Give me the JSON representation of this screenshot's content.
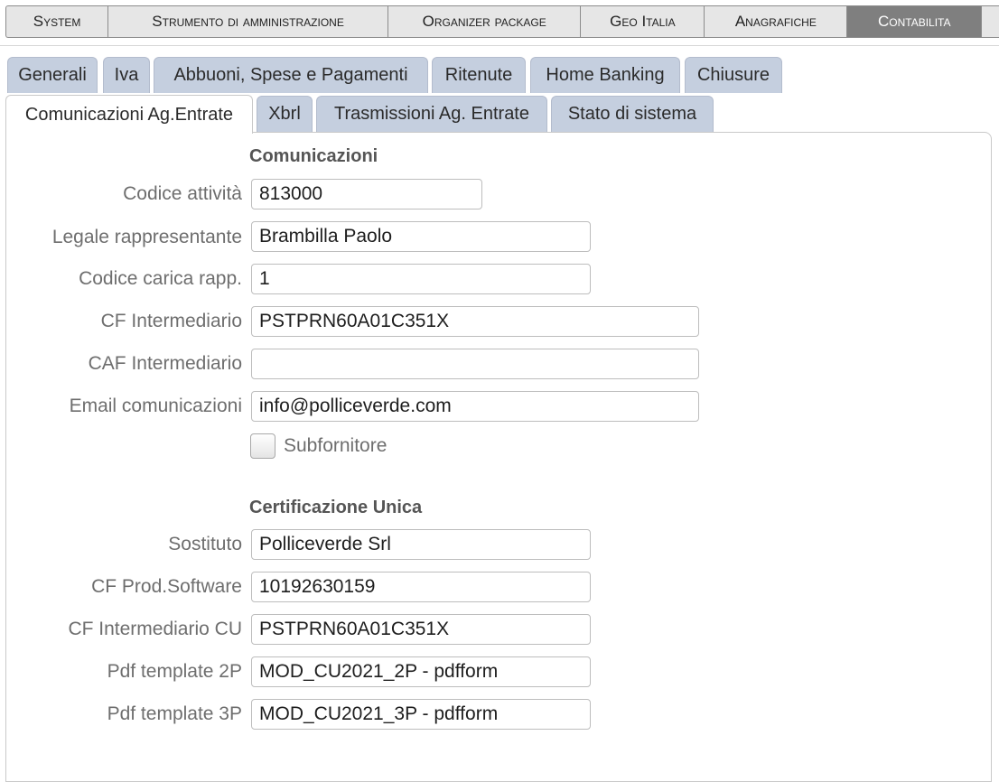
{
  "menu": {
    "items": [
      {
        "label": "System"
      },
      {
        "label": "Strumento di amministrazione"
      },
      {
        "label": "Organizer package"
      },
      {
        "label": "Geo Italia"
      },
      {
        "label": "Anagrafiche"
      },
      {
        "label": "Contabilita"
      }
    ],
    "active_color": "#7f7f7f"
  },
  "tabs": {
    "row1": [
      {
        "label": "Generali"
      },
      {
        "label": "Iva"
      },
      {
        "label": "Abbuoni, Spese e Pagamenti"
      },
      {
        "label": "Ritenute"
      },
      {
        "label": "Home Banking"
      },
      {
        "label": "Chiusure"
      }
    ],
    "row2": [
      {
        "label": "Comunicazioni Ag.Entrate"
      },
      {
        "label": "Xbrl"
      },
      {
        "label": "Trasmissioni Ag. Entrate"
      },
      {
        "label": "Stato di sistema"
      }
    ],
    "active": "Comunicazioni Ag.Entrate",
    "tab_color": "#c5cfdf"
  },
  "comunicazioni": {
    "title": "Comunicazioni",
    "codice_attivita": {
      "label": "Codice attività",
      "value": "813000"
    },
    "legale_rappresentante": {
      "label": "Legale rappresentante",
      "value": "Brambilla Paolo"
    },
    "codice_carica": {
      "label": "Codice carica rapp.",
      "value": "1"
    },
    "cf_intermediario": {
      "label": "CF Intermediario",
      "value": "PSTPRN60A01C351X"
    },
    "caf_intermediario": {
      "label": "CAF Intermediario",
      "value": ""
    },
    "email": {
      "label": "Email comunicazioni",
      "value": "info@polliceverde.com"
    },
    "subfornitore": {
      "label": "Subfornitore",
      "checked": false
    }
  },
  "certificazione": {
    "title": "Certificazione Unica",
    "sostituto": {
      "label": "Sostituto",
      "value": "Polliceverde Srl"
    },
    "cf_prod_software": {
      "label": "CF Prod.Software",
      "value": "10192630159"
    },
    "cf_intermediario_cu": {
      "label": "CF Intermediario CU",
      "value": "PSTPRN60A01C351X"
    },
    "pdf_template_2p": {
      "label": "Pdf template 2P",
      "value": "MOD_CU2021_2P - pdfform"
    },
    "pdf_template_3p": {
      "label": "Pdf template 3P",
      "value": "MOD_CU2021_3P - pdfform"
    }
  }
}
